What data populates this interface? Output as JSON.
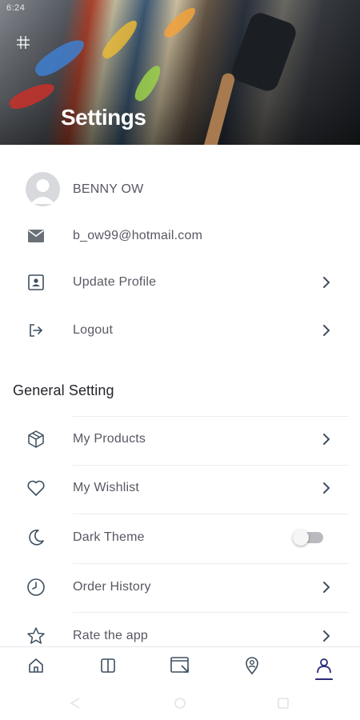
{
  "status_bar": {
    "time": "6:24"
  },
  "header": {
    "title": "Settings",
    "menu_icon": "grid-menu-icon"
  },
  "profile": {
    "name": "BENNY OW",
    "email": "b_ow99@hotmail.com",
    "update_profile_label": "Update Profile",
    "logout_label": "Logout"
  },
  "general": {
    "title": "General Setting",
    "items": [
      {
        "label": "My Products",
        "icon": "box-icon"
      },
      {
        "label": "My Wishlist",
        "icon": "heart-icon"
      },
      {
        "label": "Dark Theme",
        "icon": "moon-icon",
        "toggle": false
      },
      {
        "label": "Order History",
        "icon": "clock-icon"
      },
      {
        "label": "Rate the app",
        "icon": "star-icon"
      }
    ]
  },
  "bottom_nav": {
    "items": [
      "home-icon",
      "catalog-icon",
      "browser-icon",
      "location-icon",
      "profile-icon"
    ],
    "active": "profile-icon"
  },
  "colors": {
    "accent": "#2a2a7a",
    "text": "#585864",
    "icon": "#3d4f60"
  }
}
